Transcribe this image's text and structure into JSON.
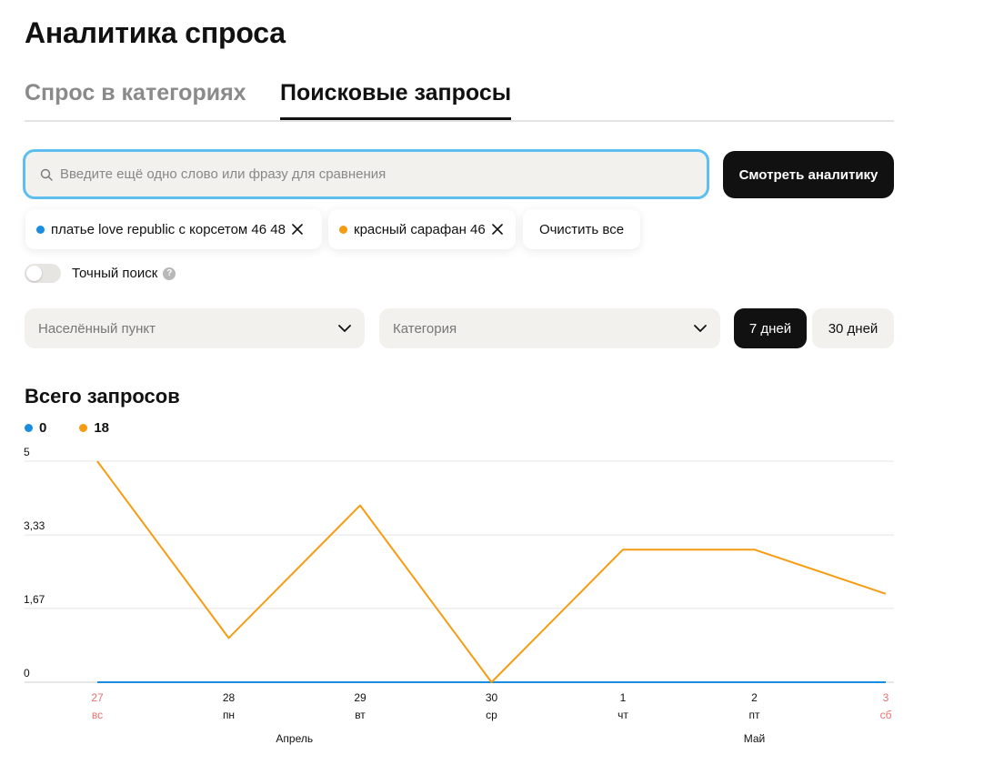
{
  "page": {
    "title": "Аналитика спроса"
  },
  "tabs": [
    {
      "label": "Спрос в категориях",
      "active": false
    },
    {
      "label": "Поисковые запросы",
      "active": true
    }
  ],
  "search": {
    "placeholder": "Введите ещё одно слово или фразу для сравнения",
    "value": "",
    "submit_label": "Смотреть аналитику"
  },
  "chips": [
    {
      "label": "платье love republic с корсетом 46 48",
      "color": "#1a8de0"
    },
    {
      "label": "красный сарафан 46",
      "color": "#f59c12"
    }
  ],
  "clear_all_label": "Очистить все",
  "exact_search": {
    "label": "Точный поиск",
    "enabled": false,
    "help": "?"
  },
  "filters": {
    "city": {
      "placeholder": "Населённый пункт"
    },
    "category": {
      "placeholder": "Категория"
    }
  },
  "periods": [
    {
      "label": "7 дней",
      "active": true
    },
    {
      "label": "30 дней",
      "active": false
    }
  ],
  "chart_section": {
    "title": "Всего запросов",
    "legend": [
      {
        "value": "0",
        "color": "#1a8de0"
      },
      {
        "value": "18",
        "color": "#f59c12"
      }
    ]
  },
  "chart_data": {
    "type": "line",
    "x": [
      "27",
      "28",
      "29",
      "30",
      "1",
      "2",
      "3"
    ],
    "weekdays": [
      "вс",
      "пн",
      "вт",
      "ср",
      "чт",
      "пт",
      "сб"
    ],
    "weekend": [
      true,
      false,
      false,
      false,
      false,
      false,
      true
    ],
    "months": [
      {
        "label": "Апрель",
        "span": [
          0,
          3
        ]
      },
      {
        "label": "Май",
        "span": [
          4,
          6
        ]
      }
    ],
    "series": [
      {
        "values": [
          0,
          0,
          0,
          0,
          0,
          0,
          0
        ],
        "color": "#1a8de0"
      },
      {
        "values": [
          5,
          1,
          4,
          0,
          3,
          3,
          2
        ],
        "color": "#f59c12"
      }
    ],
    "yticks": [
      {
        "value": 0,
        "label": "0"
      },
      {
        "value": 1.67,
        "label": "1,67"
      },
      {
        "value": 3.33,
        "label": "3,33"
      },
      {
        "value": 5,
        "label": "5"
      }
    ],
    "ylim": [
      0,
      5
    ],
    "grid": true,
    "weekend_color": "#e8736f"
  }
}
